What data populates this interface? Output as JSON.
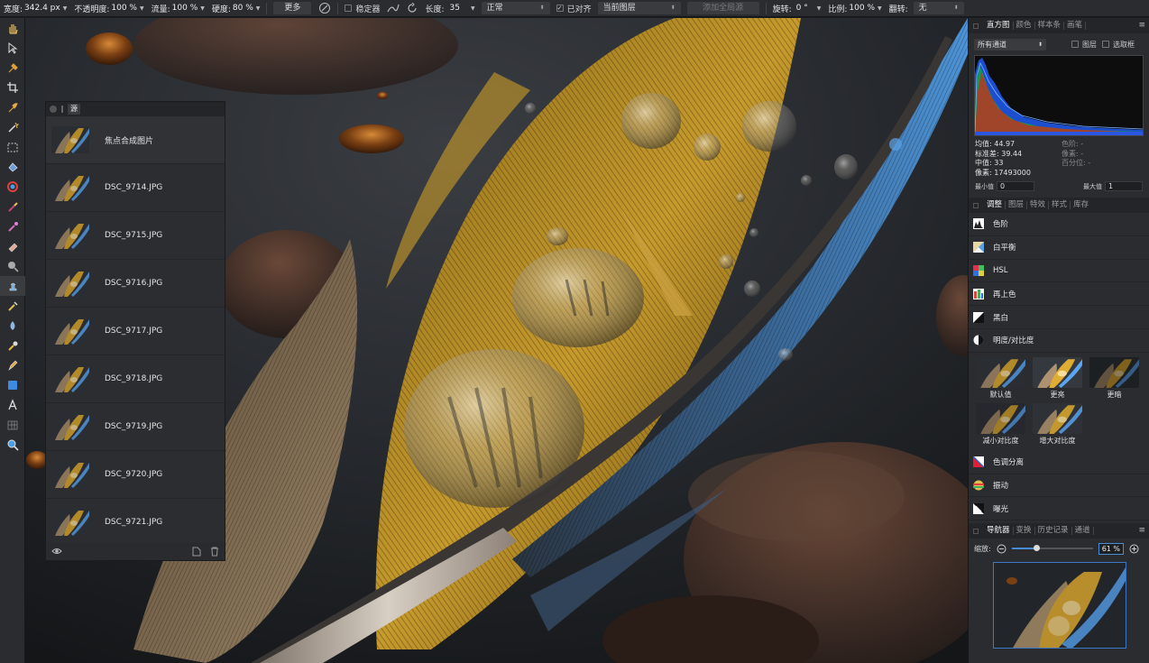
{
  "toolbar": {
    "width_label": "宽度:",
    "width_value": "342.4 px",
    "opacity_label": "不透明度:",
    "opacity_value": "100 %",
    "flow_label": "流量:",
    "flow_value": "100 %",
    "hardness_label": "硬度:",
    "hardness_value": "80 %",
    "more_button": "更多",
    "stabilizer_label": "稳定器",
    "length_label": "长度:",
    "length_value": "35",
    "blend_mode": "正常",
    "aligned_label": "已对齐",
    "source_layer": "当前图层",
    "add_all_sources": "添加全局源",
    "rotate_label": "旋转:",
    "rotate_value": "0 °",
    "scale_label": "比例:",
    "scale_value": "100 %",
    "flip_label": "翻转:",
    "flip_value": "无"
  },
  "tools": [
    "hand-tool",
    "move-tool",
    "eyedropper-tool",
    "crop-tool",
    "brush-select-tool",
    "magic-wand-tool",
    "marquee-tool",
    "flood-fill-tool",
    "color-picker-tool",
    "paint-brush-tool",
    "color-replace-tool",
    "eraser-tool",
    "dodge-tool",
    "clone-tool",
    "healing-tool",
    "blur-tool",
    "smudge-tool",
    "pen-tool",
    "shape-tool",
    "text-tool",
    "mesh-tool",
    "zoom-tool"
  ],
  "sources": {
    "tab_label": "源",
    "items": [
      {
        "label": "焦点合成图片"
      },
      {
        "label": "DSC_9714.JPG"
      },
      {
        "label": "DSC_9715.JPG"
      },
      {
        "label": "DSC_9716.JPG"
      },
      {
        "label": "DSC_9717.JPG"
      },
      {
        "label": "DSC_9718.JPG"
      },
      {
        "label": "DSC_9719.JPG"
      },
      {
        "label": "DSC_9720.JPG"
      },
      {
        "label": "DSC_9721.JPG"
      }
    ]
  },
  "histogram": {
    "tabs": [
      "直方图",
      "颜色",
      "样本条",
      "画笔"
    ],
    "channel": "所有通道",
    "layer_label": "图层",
    "selection_label": "选取框",
    "mean": "均值: 44.97",
    "stddev": "标准差: 39.44",
    "median": "中值: 33",
    "pixels": "像素: 17493000",
    "level": "色阶: -",
    "count": "像素: -",
    "percentile": "百分位: -",
    "min_label": "最小值",
    "min_value": "0",
    "max_label": "最大值",
    "max_value": "1"
  },
  "adjustments": {
    "tabs": [
      "调整",
      "图层",
      "特效",
      "样式",
      "库存"
    ],
    "items": [
      "色阶",
      "白平衡",
      "HSL",
      "再上色",
      "黑白",
      "明度/对比度"
    ],
    "presets": [
      "默认值",
      "更亮",
      "更暗",
      "减小对比度",
      "增大对比度"
    ],
    "items2": [
      "色调分离",
      "振动",
      "曝光"
    ]
  },
  "navigator": {
    "tabs": [
      "导航器",
      "变换",
      "历史记录",
      "通道"
    ],
    "zoom_label": "缩放:",
    "zoom_value": "61 %",
    "zoom_fraction": 0.3
  },
  "colors": {
    "accent": "#4a8bd6",
    "panel": "#2b2c2f",
    "background": "#1b1d20"
  }
}
